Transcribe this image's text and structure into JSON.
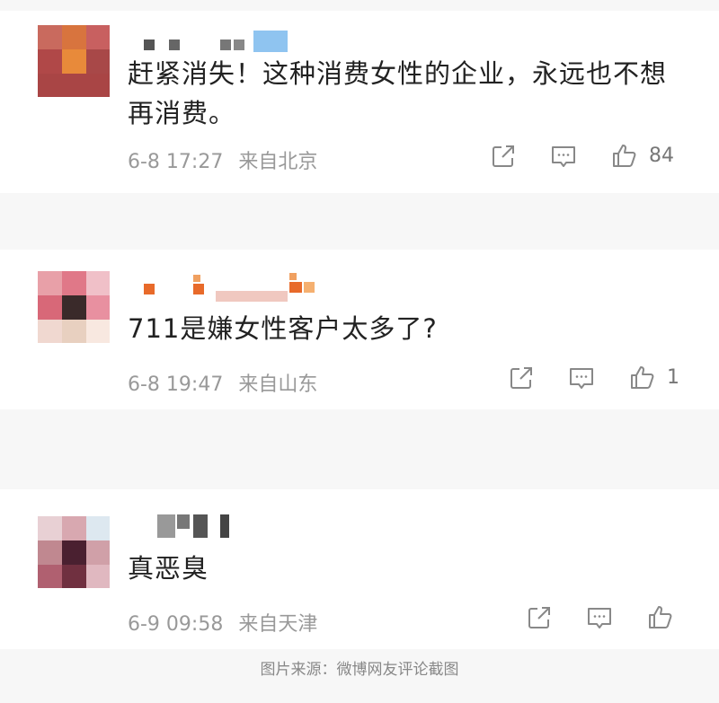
{
  "comments": [
    {
      "text": "赶紧消失！这种消费女性的企业，永远也不想再消费。",
      "date": "6-8 17:27",
      "location": "来自北京",
      "likes": "84",
      "avatar_colors": [
        "#a44a4a",
        "#e07a3a",
        "#7a2f2f",
        "#c25a4a"
      ]
    },
    {
      "text": "711是嫌女性客户太多了?",
      "date": "6-8 19:47",
      "location": "来自山东",
      "likes": "1",
      "avatar_colors": [
        "#e8a0a8",
        "#3a2a2a",
        "#f0d0c8",
        "#d07080"
      ]
    },
    {
      "text": "真恶臭",
      "date": "6-9 09:58",
      "location": "来自天津",
      "likes": "",
      "avatar_colors": [
        "#d8a8b0",
        "#4a2030",
        "#e8c8cc",
        "#b06070"
      ]
    }
  ],
  "icons": {
    "share": "share-icon",
    "comment": "comment-icon",
    "like": "thumbs-up-icon"
  },
  "caption": "图片来源：微博网友评论截图"
}
